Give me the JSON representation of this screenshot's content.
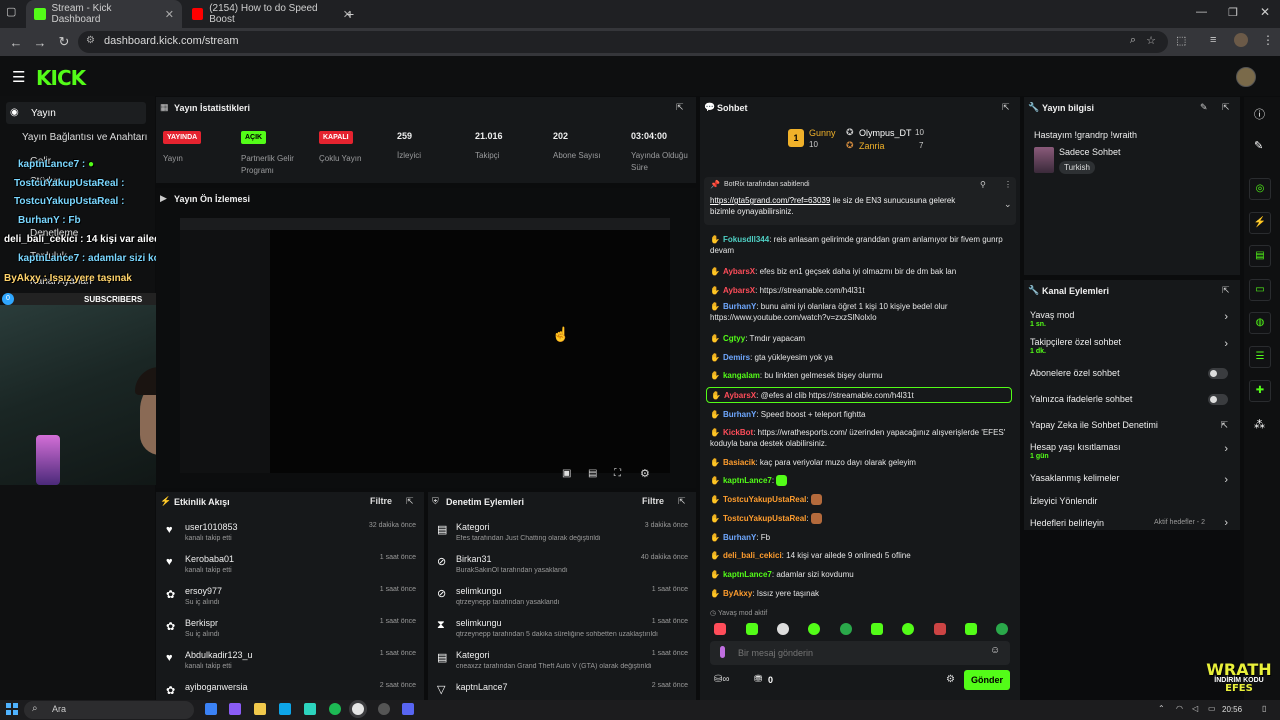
{
  "browser": {
    "tabs": [
      {
        "label": "Stream - Kick Dashboard"
      },
      {
        "label": "(2154) How to do Speed Boost"
      }
    ],
    "url": "dashboard.kick.com/stream"
  },
  "app": {
    "logo": "KICK"
  },
  "sidebar": {
    "items": [
      {
        "label": "Yayın"
      },
      {
        "label": "Yayın Bağlantısı ve Anahtarı"
      },
      {
        "label": "Gelir"
      },
      {
        "label": "Stüdyo"
      },
      {
        "label": "Denetleme"
      },
      {
        "label": "Topluluk"
      },
      {
        "label": "Kanal Ayarları"
      }
    ]
  },
  "overlay": {
    "chat": [
      {
        "user": "kaptnLance7",
        "text": ""
      },
      {
        "user": "TostcuYakupUstaReal",
        "text": ""
      },
      {
        "user": "TostcuYakupUstaReal",
        "text": ""
      },
      {
        "user": "BurhanY",
        "text": "Fb"
      },
      {
        "user": "deli_bali_cekici",
        "text": "14 kişi var ailede 9 onlinedı 5 ofline"
      },
      {
        "user": "kaptnLance7",
        "text": "adamlar sizi kovdumu"
      },
      {
        "user": "ByAkxy",
        "text": "Issız yere taşınak"
      }
    ],
    "subs_label": "SUBSCRIBERS",
    "subs_left": "0",
    "subs_right": "7",
    "brand": "WRATH",
    "brand_sub": "İNDİRİM KODU",
    "brand_code": "EFES"
  },
  "stats": {
    "title": "Yayın İstatistikleri",
    "items": [
      {
        "badge": "YAYINDA",
        "label": "Yayın",
        "color": "#e5232f"
      },
      {
        "badge": "AÇIK",
        "label": "Partnerlik Gelir Programı",
        "color": "#53fc18"
      },
      {
        "badge": "KAPALI",
        "label": "Çoklu Yayın",
        "color": "#e5232f"
      },
      {
        "value": "259",
        "label": "İzleyici"
      },
      {
        "value": "21.016",
        "label": "Takipçi"
      },
      {
        "value": "202",
        "label": "Abone Sayısı"
      },
      {
        "value": "03:04:00",
        "label": "Yayında Olduğu Süre"
      }
    ]
  },
  "preview": {
    "title": "Yayın Ön İzlemesi"
  },
  "activity": {
    "title": "Etkinlik Akışı",
    "filter": "Filtre",
    "items": [
      {
        "user": "user1010853",
        "desc": "kanalı takip etti",
        "time": "32 dakika önce",
        "icon": "heart"
      },
      {
        "user": "Kerobaba01",
        "desc": "kanalı takip etti",
        "time": "1 saat önce",
        "icon": "heart"
      },
      {
        "user": "ersoy977",
        "desc": "Su iç alındı",
        "time": "1 saat önce",
        "icon": "gift"
      },
      {
        "user": "Berkispr",
        "desc": "Su iç alındı",
        "time": "1 saat önce",
        "icon": "gift"
      },
      {
        "user": "Abdulkadir123_u",
        "desc": "kanalı takip etti",
        "time": "1 saat önce",
        "icon": "heart"
      },
      {
        "user": "ayiboganwersia",
        "desc": "",
        "time": "2 saat önce",
        "icon": "gift"
      }
    ]
  },
  "moderation": {
    "title": "Denetim Eylemleri",
    "filter": "Filtre",
    "items": [
      {
        "title": "Kategori",
        "desc": "Efes tarafından Just Chatting olarak değiştirildi",
        "time": "3 dakika önce"
      },
      {
        "title": "Birkan31",
        "desc": "BurakSakinOl tarafından yasaklandı",
        "time": "40 dakika önce"
      },
      {
        "title": "selimkungu",
        "desc": "qtrzeynepp tarafından yasaklandı",
        "time": "1 saat önce"
      },
      {
        "title": "selimkungu",
        "desc": "qtrzeynepp tarafından 5 dakika süreliğine sohbetten uzaklaştırıldı",
        "time": "1 saat önce"
      },
      {
        "title": "Kategori",
        "desc": "cneaxzz tarafından Grand Theft Auto V (GTA) olarak değiştirildi",
        "time": "1 saat önce"
      },
      {
        "title": "kaptnLance7",
        "desc": "",
        "time": "2 saat önce"
      }
    ]
  },
  "chat": {
    "title": "Sohbet",
    "top": [
      {
        "name": "Gunny",
        "count": "10"
      },
      {
        "name": "Olympus_DT",
        "count": "10"
      },
      {
        "name": "Zanria",
        "count": "7"
      }
    ],
    "pinned_by": "BotRix tarafından sabitlendi",
    "pinned_link": "https://gta5grand.com/?ref=63039",
    "pinned_text": "ile siz de EN3 sunucusuna gelerek bizimle oynayabilirsiniz.",
    "messages": [
      {
        "user": "Fokusdll344",
        "text": "reis anlasam gelirimde granddan gram anlamıyor bir fivem gunrp devam",
        "cls": "u-teal"
      },
      {
        "user": "AybarsX",
        "text": "efes biz en1 geçsek daha iyi olmazmı bir de dm bak lan",
        "cls": "u-red"
      },
      {
        "user": "AybarsX",
        "text": "https://streamable.com/h4l31t",
        "cls": "u-red"
      },
      {
        "user": "BurhanY",
        "text": "bunu aimi iyi olanlara öğret 1 kişi 10 kişiye bedel olur https://www.youtube.com/watch?v=zxzSlNolxlo",
        "cls": "u-blue"
      },
      {
        "user": "Cgtyy",
        "text": "Tmdır yapacam",
        "cls": "u-green"
      },
      {
        "user": "Demirs",
        "text": "gta yükleyesim yok ya",
        "cls": "u-blue"
      },
      {
        "user": "kangalam",
        "text": "bu linkten gelmesek bişey olurmu",
        "cls": "u-green"
      },
      {
        "user": "AybarsX",
        "text": "@efes al clib https://streamable.com/h4l31t",
        "cls": "u-red"
      },
      {
        "user": "BurhanY",
        "text": "Speed boost + teleport fightta",
        "cls": "u-blue"
      },
      {
        "user": "KickBot",
        "text": "https://wrathesports.com/ üzerinden yapacağınız alışverişlerde 'EFES' koduyla bana destek olabilirsiniz.",
        "cls": "u-red"
      },
      {
        "user": "Basiacik",
        "text": "kaç para veriyolar muzo dayı olarak geleyim",
        "cls": "u-orange"
      },
      {
        "user": "kaptnLance7",
        "text": "",
        "cls": "u-green"
      },
      {
        "user": "TostcuYakupUstaReal",
        "text": "",
        "cls": "u-orange"
      },
      {
        "user": "TostcuYakupUstaReal",
        "text": "",
        "cls": "u-orange"
      },
      {
        "user": "BurhanY",
        "text": "Fb",
        "cls": "u-blue"
      },
      {
        "user": "deli_bali_cekici",
        "text": "14 kişi var ailede 9 onlinedı 5 ofline",
        "cls": "u-orange"
      },
      {
        "user": "kaptnLance7",
        "text": "adamlar sizi kovdumu",
        "cls": "u-green"
      },
      {
        "user": "ByAkxy",
        "text": "Issız yere taşınak",
        "cls": "u-orange"
      }
    ],
    "slow": "Yavaş mod aktif",
    "placeholder": "Bir mesaj gönderin",
    "send": "Gönder",
    "points": "0"
  },
  "streaminfo": {
    "title": "Yayın bilgisi",
    "stream_title": "Hastayım !grandrp !wraith",
    "category": "Sadece Sohbet",
    "tag": "Turkish"
  },
  "channel": {
    "title": "Kanal Eylemleri",
    "items": [
      {
        "label": "Yavaş mod",
        "sub": "1 sn.",
        "ctl": "chev"
      },
      {
        "label": "Takipçilere özel sohbet",
        "sub": "1 dk.",
        "ctl": "chev"
      },
      {
        "label": "Abonelere özel sohbet",
        "sub": "",
        "ctl": "toggle"
      },
      {
        "label": "Yalnızca ifadelerle sohbet",
        "sub": "",
        "ctl": "toggle"
      },
      {
        "label": "Yapay Zeka ile Sohbet Denetimi",
        "sub": "",
        "ctl": "ext"
      },
      {
        "label": "Hesap yaşı kısıtlaması",
        "sub": "1 gün",
        "ctl": "chev"
      },
      {
        "label": "Yasaklanmış kelimeler",
        "sub": "",
        "ctl": "chev"
      },
      {
        "label": "İzleyici Yönlendir",
        "sub": "",
        "ctl": ""
      },
      {
        "label": "Hedefleri belirleyin",
        "sub": "",
        "ctl": "goal",
        "extra": "Aktif hedefler - 2"
      }
    ]
  },
  "taskbar": {
    "search": "Ara",
    "time": "20:56"
  }
}
